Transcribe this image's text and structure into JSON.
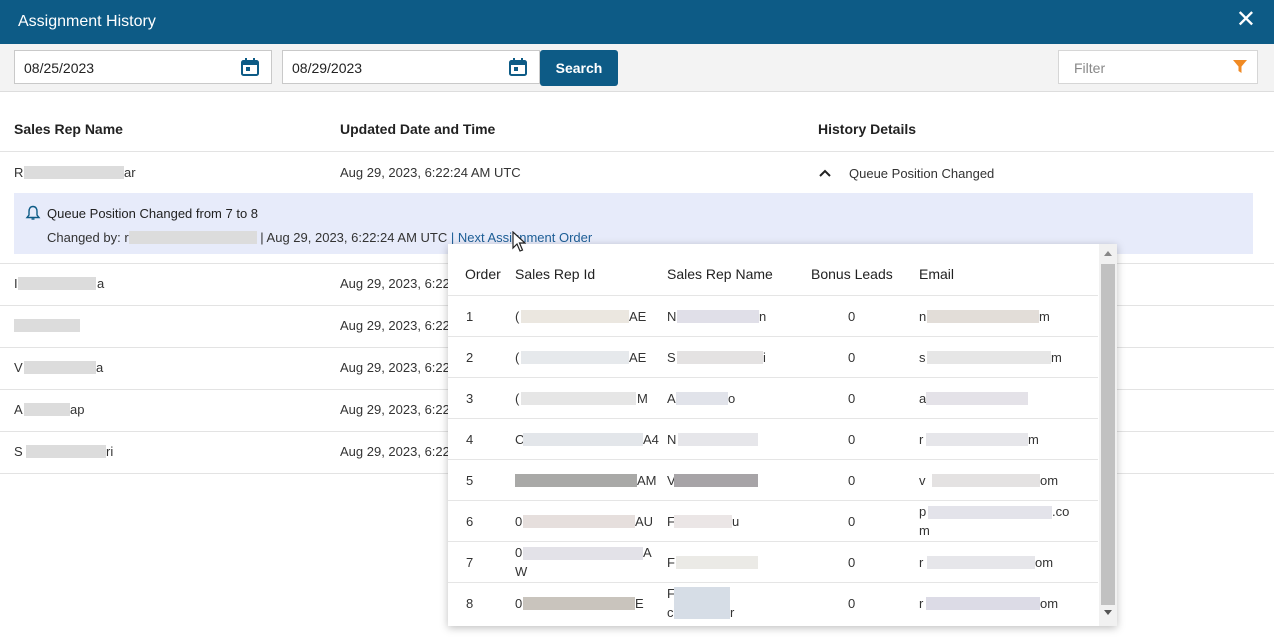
{
  "header": {
    "title": "Assignment History",
    "close_label": "✕"
  },
  "toolbar": {
    "date_from": "08/25/2023",
    "date_to": "08/29/2023",
    "search_label": "Search",
    "filter_placeholder": "Filter"
  },
  "columns": {
    "name": "Sales Rep Name",
    "updated": "Updated Date and Time",
    "details": "History Details"
  },
  "rows": [
    {
      "name_visible": "R",
      "name_end": "ar",
      "updated": "Aug 29, 2023, 6:22:24 AM UTC",
      "details": "Queue Position Changed"
    },
    {
      "name_visible": "I",
      "name_end": "a",
      "updated": "Aug 29, 2023, 6:22"
    },
    {
      "name_visible": "",
      "name_end": "",
      "updated": "Aug 29, 2023, 6:22"
    },
    {
      "name_visible": "V",
      "name_end": "a",
      "updated": "Aug 29, 2023, 6:22"
    },
    {
      "name_visible": "A",
      "name_end": "ap",
      "updated": "Aug 29, 2023, 6:22"
    },
    {
      "name_visible": "S",
      "name_end": "ri",
      "updated": "Aug 29, 2023, 6:22"
    }
  ],
  "detail": {
    "line1": "Queue Position Changed from 7 to 8",
    "changed_by_label": "Changed by: r",
    "changed_info": " | Aug 29, 2023, 6:22:24 AM UTC ",
    "link": "| Next Assignment Order"
  },
  "popup": {
    "headers": {
      "order": "Order",
      "rep_id": "Sales Rep Id",
      "rep_name": "Sales Rep Name",
      "bonus": "Bonus Leads",
      "email": "Email"
    },
    "rows": [
      {
        "order": "1",
        "id_start": "(",
        "id_end": "AE",
        "name_start": "N",
        "name_end": "n",
        "bonus": "0",
        "email_start": "n",
        "email_end": "m"
      },
      {
        "order": "2",
        "id_start": "(",
        "id_end": "AE",
        "name_start": "S",
        "name_end": "i",
        "bonus": "0",
        "email_start": "s",
        "email_end": "m"
      },
      {
        "order": "3",
        "id_start": "(",
        "id_end": "M",
        "name_start": "A",
        "name_end": "o",
        "bonus": "0",
        "email_start": "a",
        "email_end": ""
      },
      {
        "order": "4",
        "id_start": "C",
        "id_end": "A4",
        "name_start": "N",
        "name_end": "",
        "bonus": "0",
        "email_start": "r",
        "email_end": "m"
      },
      {
        "order": "5",
        "id_start": "",
        "id_end": "AM",
        "name_start": "V",
        "name_end": "",
        "bonus": "0",
        "email_start": "v",
        "email_end": "om"
      },
      {
        "order": "6",
        "id_start": "0",
        "id_end": "AU",
        "name_start": "F",
        "name_end": "u",
        "bonus": "0",
        "email_start": "p",
        "email_end": ".co",
        "email_line2": "m"
      },
      {
        "order": "7",
        "id_start": "0",
        "id_end": "A",
        "id_line2": "W",
        "name_start": "F",
        "name_end": "",
        "bonus": "0",
        "email_start": "r",
        "email_end": "om"
      },
      {
        "order": "8",
        "id_start": "0",
        "id_end": "E",
        "name_start": "F",
        "name_line2": "c",
        "name_end": "r",
        "bonus": "0",
        "email_start": "r",
        "email_end": "om"
      }
    ]
  },
  "colors": {
    "brand": "#0d5b86",
    "detail_bg": "#e7ebfa",
    "link": "#1d5e96",
    "filter_icon": "#f08a24"
  }
}
